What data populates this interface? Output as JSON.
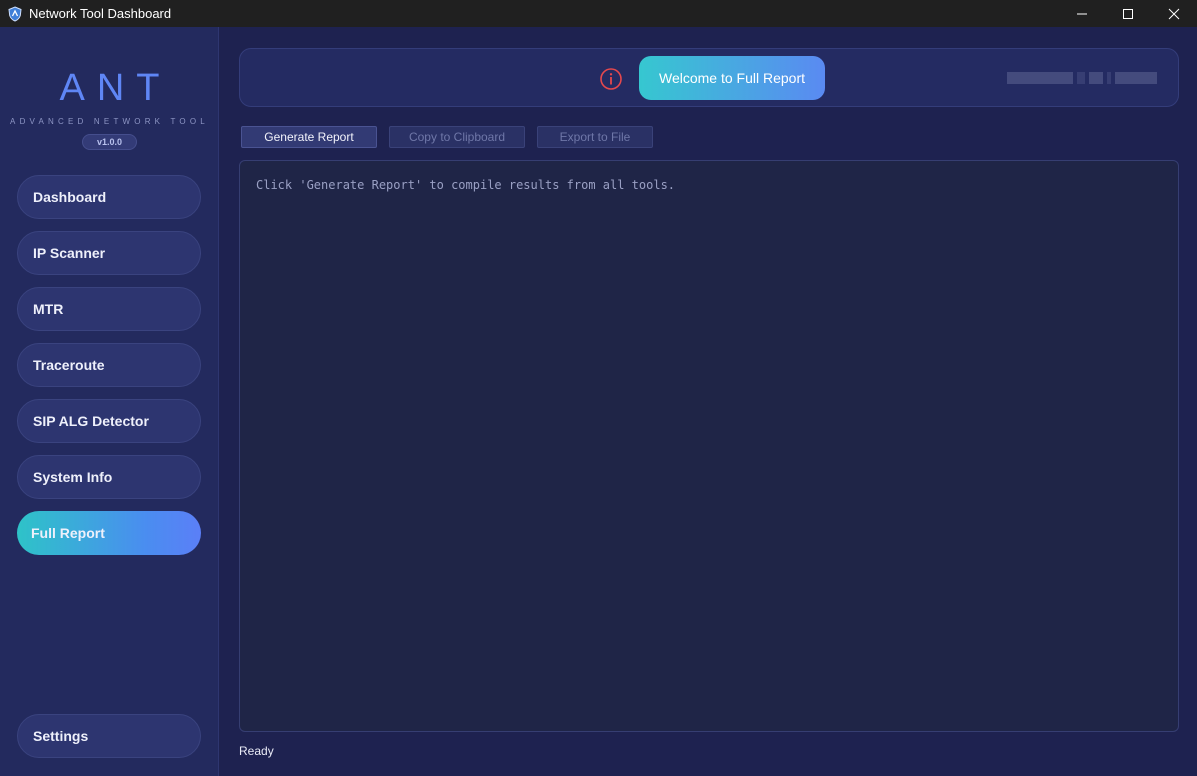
{
  "window": {
    "title": "Network Tool Dashboard",
    "icon": "shield-icon",
    "controls": [
      "minimize-icon",
      "maximize-icon",
      "close-icon"
    ]
  },
  "sidebar": {
    "logo": "ANT",
    "tagline": "ADVANCED NETWORK TOOL",
    "version": "v1.0.0",
    "items": [
      {
        "label": "Dashboard"
      },
      {
        "label": "IP Scanner"
      },
      {
        "label": "MTR"
      },
      {
        "label": "Traceroute"
      },
      {
        "label": "SIP ALG Detector"
      },
      {
        "label": "System Info"
      },
      {
        "label": "Full Report",
        "active": true
      }
    ],
    "settings_label": "Settings"
  },
  "header": {
    "info_icon": "info-icon",
    "welcome_label": "Welcome to Full Report"
  },
  "toolbar": {
    "generate_label": "Generate Report",
    "copy_label": "Copy to Clipboard",
    "export_label": "Export to File"
  },
  "report": {
    "placeholder": "Click 'Generate Report' to compile results from all tools."
  },
  "status": {
    "text": "Ready"
  },
  "colors": {
    "background": "#1e2250",
    "sidebar": "#232a5e",
    "accent_start": "#2ec3c8",
    "accent_end": "#5b7ff7",
    "info_red": "#e5484d",
    "logo_blue": "#5f86f5"
  }
}
